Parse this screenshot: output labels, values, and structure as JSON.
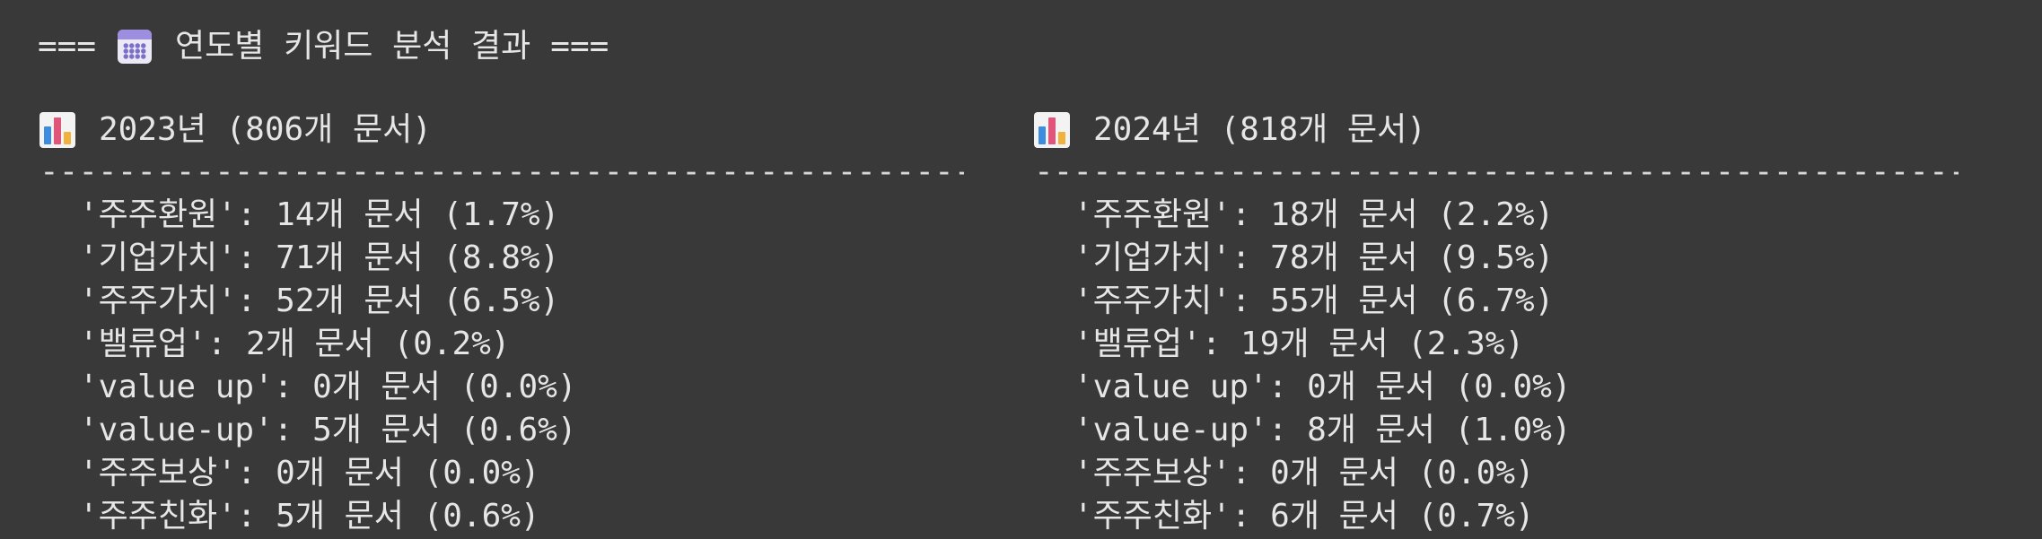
{
  "header": {
    "prefix": "===",
    "icon": "calendar-icon",
    "title": "연도별 키워드 분석 결과",
    "suffix": "==="
  },
  "columns": [
    {
      "icon": "bar-chart-icon",
      "title": "2023년 (806개 문서)",
      "rule": "-----------------------------------------------------------",
      "rows": [
        "'주주환원': 14개 문서 (1.7%)",
        "'기업가치': 71개 문서 (8.8%)",
        "'주주가치': 52개 문서 (6.5%)",
        "'밸류업': 2개 문서 (0.2%)",
        "'value up': 0개 문서 (0.0%)",
        "'value-up': 5개 문서 (0.6%)",
        "'주주보상': 0개 문서 (0.0%)",
        "'주주친화': 5개 문서 (0.6%)"
      ]
    },
    {
      "icon": "bar-chart-icon",
      "title": "2024년 (818개 문서)",
      "rule": "-----------------------------------------------------------",
      "rows": [
        "'주주환원': 18개 문서 (2.2%)",
        "'기업가치': 78개 문서 (9.5%)",
        "'주주가치': 55개 문서 (6.7%)",
        "'밸류업': 19개 문서 (2.3%)",
        "'value up': 0개 문서 (0.0%)",
        "'value-up': 8개 문서 (1.0%)",
        "'주주보상': 0개 문서 (0.0%)",
        "'주주친화': 6개 문서 (0.7%)"
      ]
    }
  ]
}
